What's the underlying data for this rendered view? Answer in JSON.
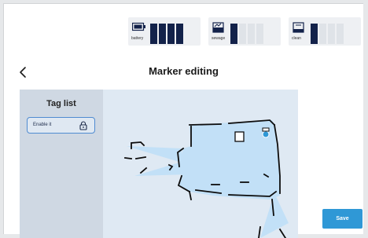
{
  "status": {
    "battery": {
      "label": "battery",
      "level": "4 of 4"
    },
    "sewage": {
      "label": "sewage",
      "level": "1 of 4"
    },
    "clean": {
      "label": "clean",
      "level": "1 of 4"
    }
  },
  "header": {
    "title": "Marker editing",
    "back_icon": "chevron-left-icon"
  },
  "sidebar": {
    "title": "Tag list",
    "items": [
      {
        "label": "Enable it",
        "icon": "lock-icon"
      }
    ]
  },
  "actions": {
    "save_label": "Save"
  },
  "colors": {
    "accent": "#2f98d6",
    "bar_filled": "#13224a",
    "sidebar_bg": "#cfd8e3",
    "map_fill": "#c2e0f7",
    "tag_border": "#4f8bd1"
  }
}
